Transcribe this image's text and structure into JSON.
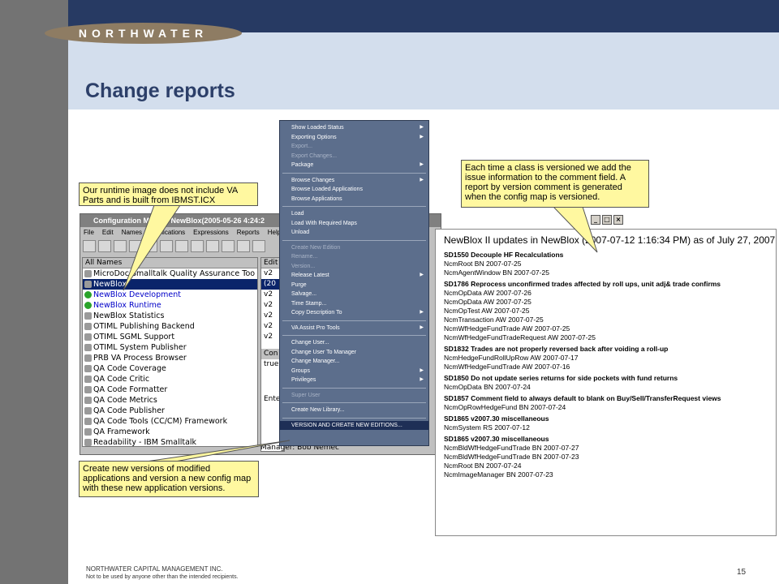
{
  "logo": "NORTHWATER",
  "slide_title": "Change reports",
  "footer": {
    "company": "NORTHWATER CAPITAL MANAGEMENT INC.",
    "notice": "Not to be used by anyone other than the intended recipients.",
    "page_number": "15"
  },
  "callouts": {
    "runtime": "Our runtime image does not include VA Parts and is built from IBMST.ICX",
    "versioned": "Each time a class is versioned we add the issue information to the comment field. A report by version comment is generated when the config map is versioned.",
    "create_versions": "Create new versions of modified applications and version a new config map with these new application versions."
  },
  "config_window": {
    "title": "Configuration Ma    ser: NewBlox(2005-05-26 4:24:2",
    "menu": [
      "File",
      "Edit",
      "Names",
      "Applications",
      "Expressions",
      "Reports",
      "Help"
    ],
    "all_names_header": "All Names",
    "edit_header": "Edit",
    "items": [
      "MicroDoc Smalltalk Quality Assurance Too",
      "NewBlox",
      "NewBlox Development",
      "NewBlox Runtime",
      "NewBlox Statistics",
      "OTIML Publishing Backend",
      "OTIML SGML Support",
      "OTIML System Publisher",
      "PRB VA Process Browser",
      "QA Code Coverage",
      "QA Code Critic",
      "QA Code Formatter",
      "QA Code Metrics",
      "QA Code Publisher",
      "QA Code Tools (CC/CM) Framework",
      "QA Framework",
      "Readability - IBM Smalltalk"
    ],
    "mid_items": [
      "v2",
      "(20",
      "v2",
      "v2",
      "v2",
      "v2",
      "v2"
    ],
    "con_label": "Con",
    "true_label": "true",
    "ente_label": "Ente",
    "manager_label": "Manager: Bob Nemec"
  },
  "context_menu": {
    "groups": [
      [
        {
          "label": "Show Loaded Status",
          "sub": true
        },
        {
          "label": "Exporting Options",
          "sub": true
        },
        {
          "label": "Export...",
          "disabled": true
        },
        {
          "label": "Export Changes...",
          "disabled": true
        },
        {
          "label": "Package",
          "sub": true
        }
      ],
      [
        {
          "label": "Browse Changes",
          "sub": true
        },
        {
          "label": "Browse Loaded Applications"
        },
        {
          "label": "Browse Applications"
        }
      ],
      [
        {
          "label": "Load"
        },
        {
          "label": "Load With Required Maps"
        },
        {
          "label": "Unload"
        }
      ],
      [
        {
          "label": "Create New Edition",
          "disabled": true
        },
        {
          "label": "Rename...",
          "disabled": true
        },
        {
          "label": "Version...",
          "disabled": true
        },
        {
          "label": "Release Latest",
          "sub": true
        },
        {
          "label": "Purge"
        },
        {
          "label": "Salvage..."
        },
        {
          "label": "Time Stamp..."
        },
        {
          "label": "Copy Description To",
          "sub": true
        }
      ],
      [
        {
          "label": "VA Assist Pro Tools",
          "sub": true
        }
      ],
      [
        {
          "label": "Change User..."
        },
        {
          "label": "Change User To Manager"
        },
        {
          "label": "Change Manager..."
        },
        {
          "label": "Groups",
          "sub": true
        },
        {
          "label": "Privileges",
          "sub": true
        }
      ],
      [
        {
          "label": "Super User",
          "disabled": true
        }
      ],
      [
        {
          "label": "Create New Library..."
        }
      ],
      [
        {
          "label": "VERSION AND CREATE NEW EDITIONS...",
          "selected": true
        }
      ]
    ]
  },
  "report": {
    "title": "NewBlox II updates in NewBlox (2007-07-12 1:16:34 PM) as of July 27, 2007",
    "sections": [
      {
        "heading": "SD1550 Decouple HF Recalculations",
        "items": [
          "NcmRoot  BN 2007-07-25",
          "NcmAgentWindow  BN 2007-07-25"
        ]
      },
      {
        "heading": "SD1786 Reprocess unconfirmed trades affected by roll ups, unit adj& trade confirms",
        "items": [
          "NcmOpData  AW 2007-07-26",
          "NcmOpData  AW 2007-07-25",
          "NcmOpTest  AW 2007-07-25",
          "NcmTransaction  AW 2007-07-25",
          "NcmWfHedgeFundTrade  AW 2007-07-25",
          "NcmWfHedgeFundTradeRequest  AW 2007-07-25"
        ]
      },
      {
        "heading": "SD1832 Trades are not properly reversed back after voiding a roll-up",
        "items": [
          "NcmHedgeFundRollUpRow  AW 2007-07-17",
          "NcmWfHedgeFundTrade  AW 2007-07-16"
        ]
      },
      {
        "heading": "SD1850 Do not update series returns for side pockets with fund returns",
        "items": [
          "NcmOpData  BN 2007-07-24"
        ]
      },
      {
        "heading": "SD1857 Comment field to always default to blank on Buy/Sell/TransferRequest views",
        "items": [
          "NcmOpRowHedgeFund  BN 2007-07-24"
        ]
      },
      {
        "heading": "SD1865 v2007.30 miscellaneous",
        "items": [
          "NcmSystem  RS 2007-07-12"
        ]
      },
      {
        "heading": "SD1865 v2007.30 miscellaneous",
        "items": [
          "NcmBldWfHedgeFundTrade  BN 2007-07-27",
          "NcmBldWfHedgeFundTrade  BN 2007-07-23",
          "NcmRoot  BN 2007-07-24",
          "NcmImageManager  BN 2007-07-23"
        ]
      }
    ]
  }
}
